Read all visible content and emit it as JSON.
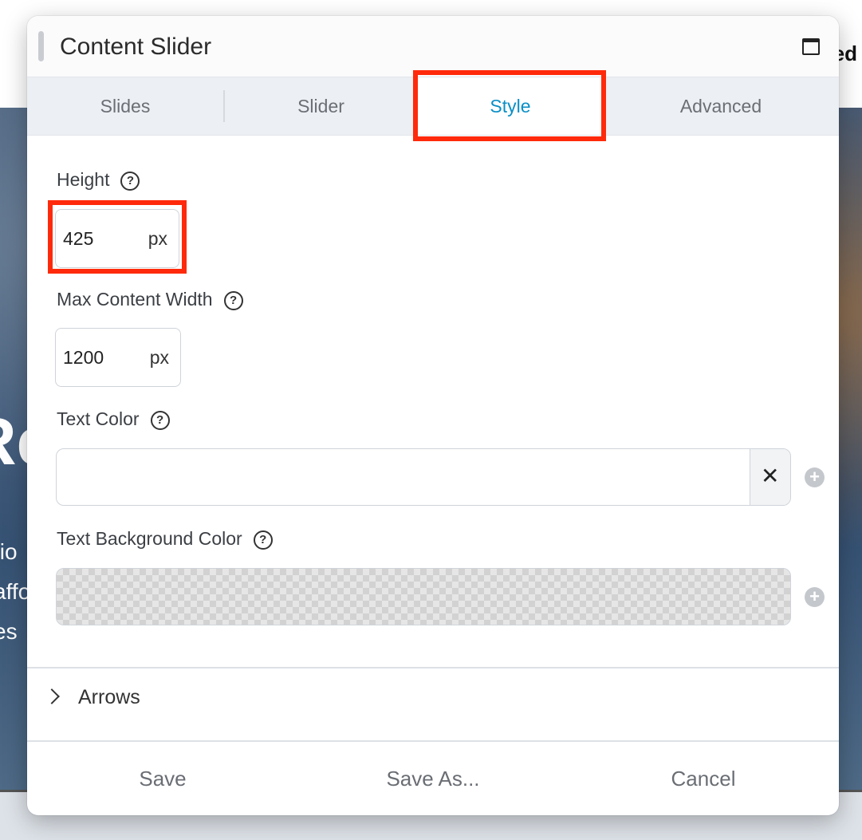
{
  "background": {
    "top_text": "ed",
    "hero_heading": "Re",
    "hero_lines": [
      "tio",
      "affo",
      "es"
    ]
  },
  "modal": {
    "title": "Content Slider",
    "maximize_icon": "window-maximize-icon"
  },
  "tabs": [
    {
      "label": "Slides",
      "active": false
    },
    {
      "label": "Slider",
      "active": false
    },
    {
      "label": "Style",
      "active": true
    },
    {
      "label": "Advanced",
      "active": false
    }
  ],
  "fields": {
    "height": {
      "label": "Height",
      "value": "425",
      "unit": "px"
    },
    "max_content_width": {
      "label": "Max Content Width",
      "value": "1200",
      "unit": "px"
    },
    "text_color": {
      "label": "Text Color",
      "value": "",
      "clear_label": "✕",
      "add_label": "+"
    },
    "text_background_color": {
      "label": "Text Background Color",
      "value": "",
      "add_label": "+"
    }
  },
  "help_label": "?",
  "sections": {
    "arrows": {
      "label": "Arrows",
      "expanded": false
    }
  },
  "footer": {
    "save": "Save",
    "save_as": "Save As...",
    "cancel": "Cancel"
  },
  "colors": {
    "accent": "#0b8fc6",
    "highlight": "#ff2a0b"
  }
}
